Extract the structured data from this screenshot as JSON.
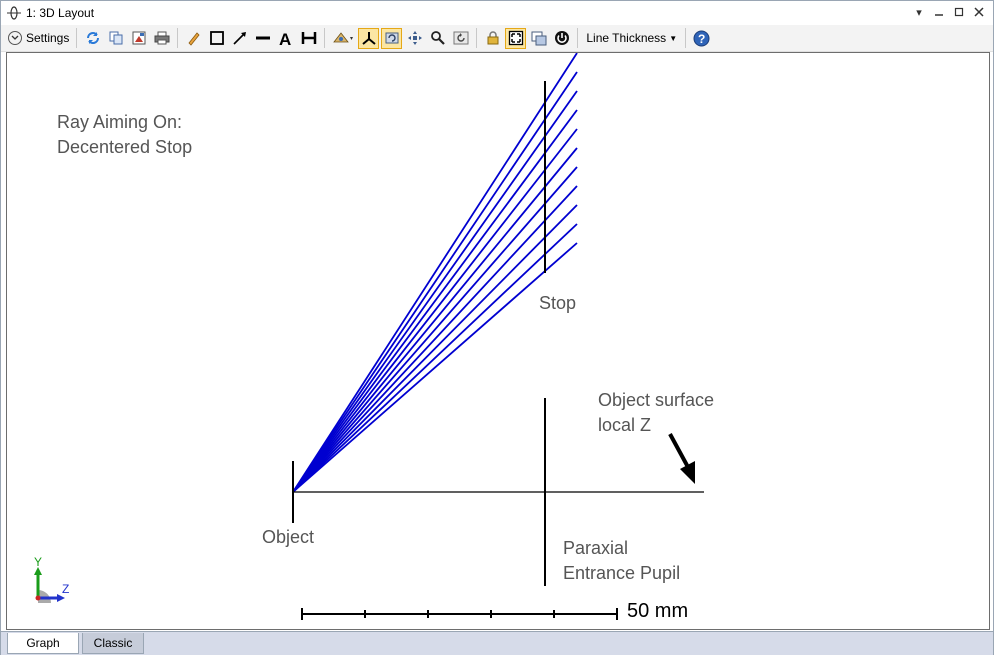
{
  "window": {
    "title": "1: 3D Layout",
    "controls": [
      "chevron-down-icon",
      "minimize-icon",
      "maximize-icon",
      "close-icon"
    ]
  },
  "toolbar": {
    "settings_label": "Settings",
    "line_thickness_label": "Line Thickness",
    "buttons": [
      "refresh-icon",
      "copy-icon",
      "export-icon",
      "print-icon",
      "pencil-icon",
      "rectangle-icon",
      "arrow-icon",
      "line-icon",
      "text-icon",
      "dimension-icon",
      "rotate-icon",
      "axes-icon",
      "reset-view-icon",
      "pan-icon",
      "zoom-icon",
      "undo-view-icon",
      "lock-icon",
      "fit-icon",
      "window-icon",
      "power-icon",
      "help-icon"
    ],
    "accent_active": "#fbe6a3"
  },
  "plot": {
    "annotation_title": "Ray Aiming On:",
    "annotation_subtitle": "Decentered Stop",
    "stop_label": "Stop",
    "object_label": "Object",
    "object_surface_label_1": "Object surface",
    "object_surface_label_2": "local Z",
    "pupil_label_1": "Paraxial",
    "pupil_label_2": "Entrance Pupil",
    "scale_label": "50 mm",
    "axis_y": "Y",
    "axis_z": "Z",
    "ray_color": "#0000d0",
    "ray_count": 11
  },
  "tabs": {
    "graph": "Graph",
    "classic": "Classic"
  }
}
